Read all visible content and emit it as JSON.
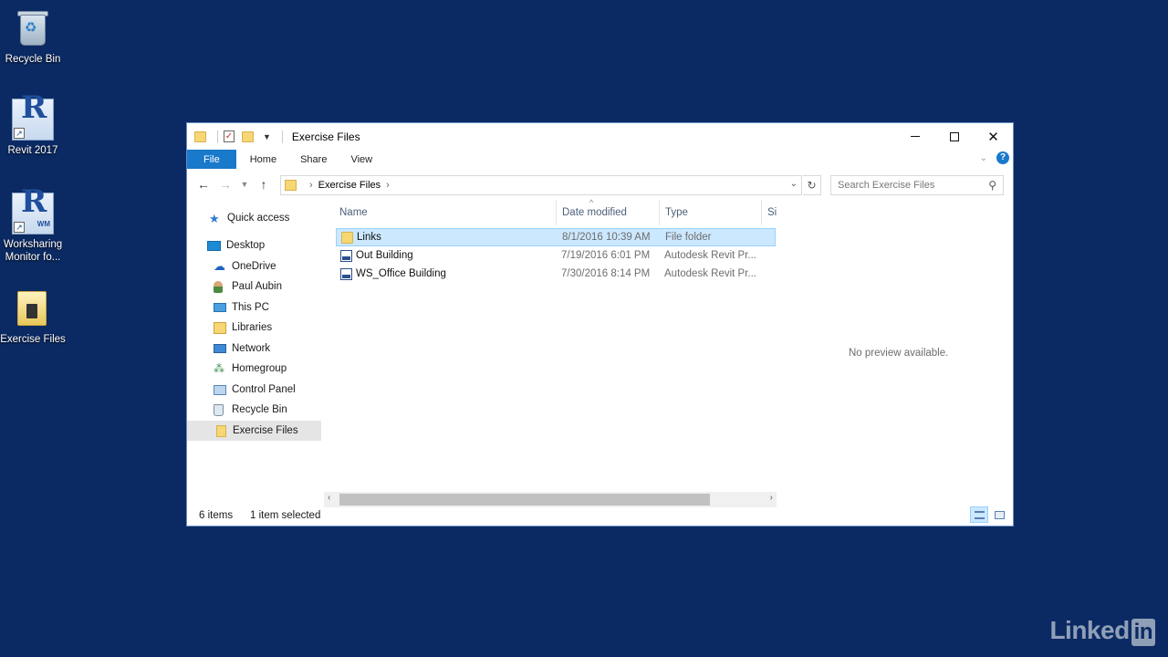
{
  "desktop": {
    "icons": [
      {
        "label": "Recycle Bin"
      },
      {
        "label": "Revit 2017"
      },
      {
        "label": "Worksharing Monitor fo..."
      },
      {
        "label": "Exercise Files"
      }
    ]
  },
  "window": {
    "title": "Exercise Files",
    "ribbon_tabs": [
      "File",
      "Home",
      "Share",
      "View"
    ],
    "help_glyph": "?",
    "address": {
      "crumbs": [
        "Exercise Files"
      ]
    },
    "search": {
      "placeholder": "Search Exercise Files"
    },
    "nav_pane": [
      {
        "label": "Quick access",
        "icon": "star-icon"
      },
      {
        "label": "Desktop",
        "icon": "desktop-icon"
      },
      {
        "label": "OneDrive",
        "icon": "onedrive-icon"
      },
      {
        "label": "Paul Aubin",
        "icon": "user-icon"
      },
      {
        "label": "This PC",
        "icon": "pc-icon"
      },
      {
        "label": "Libraries",
        "icon": "libraries-icon"
      },
      {
        "label": "Network",
        "icon": "network-icon"
      },
      {
        "label": "Homegroup",
        "icon": "homegroup-icon"
      },
      {
        "label": "Control Panel",
        "icon": "control-panel-icon"
      },
      {
        "label": "Recycle Bin",
        "icon": "recycle-bin-icon"
      },
      {
        "label": "Exercise Files",
        "icon": "folder-icon",
        "selected": true
      }
    ],
    "columns": [
      "Name",
      "Date modified",
      "Type",
      "Si"
    ],
    "files": [
      {
        "name": "Links",
        "date": "8/1/2016 10:39 AM",
        "type": "File folder",
        "icon": "folder-icon",
        "selected": true
      },
      {
        "name": "Out Building",
        "date": "7/19/2016 6:01 PM",
        "type": "Autodesk Revit Pr...",
        "icon": "rvt-file-icon"
      },
      {
        "name": "WS_Office Building",
        "date": "7/30/2016 8:14 PM",
        "type": "Autodesk Revit Pr...",
        "icon": "rvt-file-icon"
      }
    ],
    "preview_text": "No preview available.",
    "status": {
      "items": "6 items",
      "selected": "1 item selected"
    }
  },
  "watermark": {
    "text": "Linked",
    "badge": "in"
  },
  "colors": {
    "desktop": "#0b2a63",
    "accent": "#1979ca",
    "selection": "#cce8ff"
  }
}
